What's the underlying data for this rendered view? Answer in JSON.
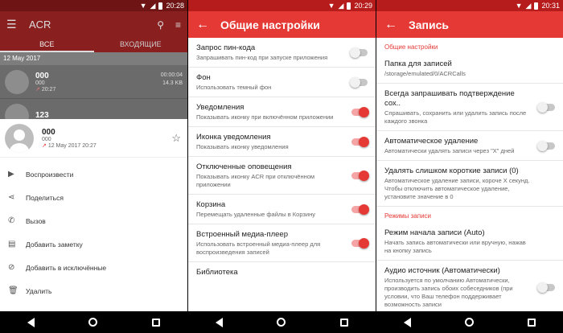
{
  "colors": {
    "accent": "#e53935",
    "status": "#b71c1c",
    "dim_accent": "#8a1f1f"
  },
  "screen1": {
    "status_time": "20:28",
    "app_title": "ACR",
    "tabs": [
      "ВСЕ",
      "ВХОДЯЩИЕ"
    ],
    "date": "12 May 2017",
    "calls": [
      {
        "name": "000",
        "sub": "000",
        "duration": "00:00:04",
        "size": "14.3 KB",
        "time": "20:27"
      },
      {
        "name": "123",
        "sub": "",
        "duration": "",
        "size": "",
        "time": ""
      }
    ],
    "sheet": {
      "name": "000",
      "number": "000",
      "datetime": "12 May 2017 20:27",
      "actions": [
        {
          "icon": "play-icon",
          "label": "Воспроизвести"
        },
        {
          "icon": "share-icon",
          "label": "Поделиться"
        },
        {
          "icon": "phone-icon",
          "label": "Вызов"
        },
        {
          "icon": "note-icon",
          "label": "Добавить заметку"
        },
        {
          "icon": "block-icon",
          "label": "Добавить в исключённые"
        },
        {
          "icon": "trash-icon",
          "label": "Удалить"
        }
      ]
    }
  },
  "screen2": {
    "status_time": "20:29",
    "title": "Общие настройки",
    "items": [
      {
        "title": "Запрос пин-кода",
        "desc": "Запрашивать пин-код при запуске приложения",
        "on": false
      },
      {
        "title": "Фон",
        "desc": "Использовать темный фон",
        "on": false
      },
      {
        "title": "Уведомления",
        "desc": "Показывать иконку при включённом приложении",
        "on": true
      },
      {
        "title": "Иконка уведомления",
        "desc": "Показывать иконку уведомления",
        "on": true
      },
      {
        "title": "Отключенные оповещения",
        "desc": "Показывать иконку ACR при отключённом приложении",
        "on": true
      },
      {
        "title": "Корзина",
        "desc": "Перемещать удаленные файлы в Корзину",
        "on": true
      },
      {
        "title": "Встроенный медиа-плеер",
        "desc": "Использовать встроенный медиа-плеер для воспроизведения записей",
        "on": true
      },
      {
        "title": "Библиотека",
        "desc": "",
        "on": null
      }
    ]
  },
  "screen3": {
    "status_time": "20:31",
    "title": "Запись",
    "section1": "Общие настройки",
    "folder_title": "Папка для записей",
    "folder_path": "/storage/emulated/0/ACRCalls",
    "items": [
      {
        "title": "Всегда запрашивать подтверждение сох..",
        "desc": "Спрашивать, сохранить или удалить запись после каждого звонка",
        "on": false
      },
      {
        "title": "Автоматическое удаление",
        "desc": "Автоматически удалять записи через \"X\" дней",
        "on": false
      },
      {
        "title": "Удалять слишком короткие записи (0)",
        "desc": "Автоматическое удаление записи, короче X секунд. Чтобы отключить автоматическое удаление, установите значение в 0",
        "on": null
      }
    ],
    "section2": "Режимы записи",
    "items2": [
      {
        "title": "Режим начала записи (Auto)",
        "desc": "Начать запись автоматически или вручную, нажав на кнопку запись",
        "on": null
      },
      {
        "title": "Аудио источник (Автоматически)",
        "desc": "Используется по умолчанию Автоматически, производить запись обоих собеседников (при условии, что Ваш телефон поддерживает возможность записи",
        "on": false
      }
    ]
  }
}
